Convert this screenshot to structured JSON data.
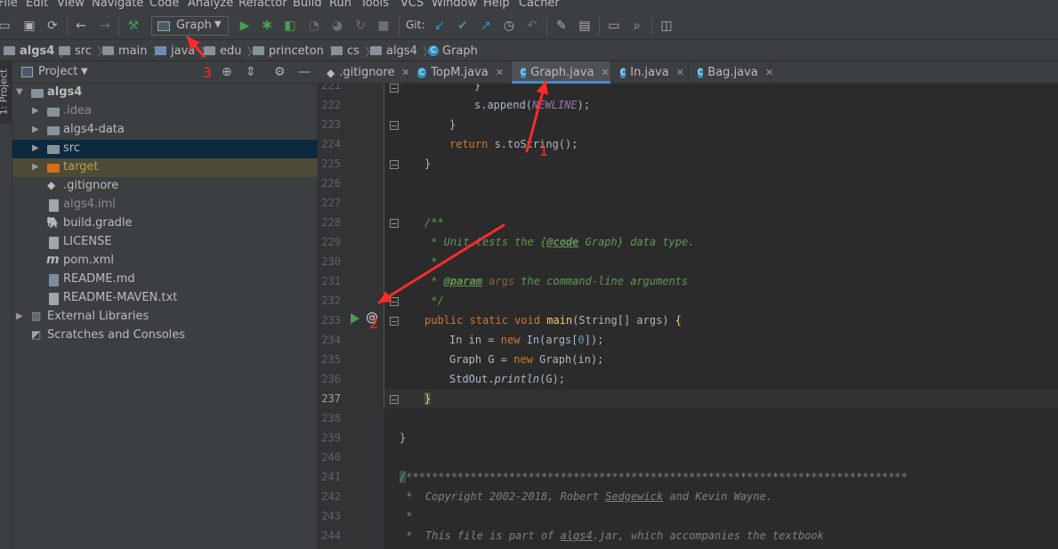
{
  "menu": [
    "File",
    "Edit",
    "View",
    "Navigate",
    "Code",
    "Analyze",
    "Refactor",
    "Build",
    "Run",
    "Tools",
    "VCS",
    "Window",
    "Help",
    "Cacher"
  ],
  "toolbar": {
    "run_config": "Graph",
    "git_label": "Git:"
  },
  "breadcrumbs": [
    "algs4",
    "src",
    "main",
    "java",
    "edu",
    "princeton",
    "cs",
    "algs4",
    "Graph"
  ],
  "side_tab": "1: Project",
  "project": {
    "title": "Project",
    "tree": [
      {
        "label": "algs4",
        "color": "#bbbbbb",
        "bold": true
      },
      {
        "label": ".idea",
        "color": "#8c8c8c"
      },
      {
        "label": "algs4-data",
        "color": "#bbbbbb"
      },
      {
        "label": "src",
        "color": "#bbbbbb"
      },
      {
        "label": "target",
        "color": "#b8a04a"
      },
      {
        "label": ".gitignore",
        "color": "#bbbbbb"
      },
      {
        "label": "algs4.iml",
        "color": "#8c8c8c"
      },
      {
        "label": "build.gradle",
        "color": "#bbbbbb"
      },
      {
        "label": "LICENSE",
        "color": "#bbbbbb"
      },
      {
        "label": "pom.xml",
        "color": "#bbbbbb"
      },
      {
        "label": "README.md",
        "color": "#bbbbbb"
      },
      {
        "label": "README-MAVEN.txt",
        "color": "#bbbbbb"
      },
      {
        "label": "External Libraries",
        "color": "#bbbbbb"
      },
      {
        "label": "Scratches and Consoles",
        "color": "#bbbbbb"
      }
    ]
  },
  "tabs": [
    {
      "label": ".gitignore",
      "active": false
    },
    {
      "label": "TopM.java",
      "active": false
    },
    {
      "label": "Graph.java",
      "active": true
    },
    {
      "label": "In.java",
      "active": false
    },
    {
      "label": "Bag.java",
      "active": false
    }
  ],
  "code": {
    "line_numbers": [
      "221",
      "222",
      "223",
      "224",
      "225",
      "226",
      "227",
      "228",
      "229",
      "230",
      "231",
      "232",
      "233",
      "234",
      "235",
      "236",
      "237",
      "238",
      "239",
      "240",
      "241",
      "242",
      "243",
      "244"
    ],
    "current_line": "237",
    "lines": {
      "l221": "}",
      "l222_a": "s.append(",
      "l222_b": "NEWLINE",
      "l222_c": ");",
      "l223": "}",
      "l224_kw": "return",
      "l224_rest": " s.toString();",
      "l225": "}",
      "l228": "/**",
      "l229_a": " * Unit tests the ",
      "l229_b": "{",
      "l229_c": "@code",
      "l229_d": " Graph}",
      "l229_e": " data type.",
      "l230": " *",
      "l231_a": " * ",
      "l231_b": "@param",
      "l231_c": " args",
      "l231_d": " the command-line arguments",
      "l232": " */",
      "l233_kw": "public static void ",
      "l233_fn": "main",
      "l233_rest": "(String[] args) ",
      "l233_brace": "{",
      "l234_a": "In in = ",
      "l234_kw": "new",
      "l234_b": " In(args[",
      "l234_num": "0",
      "l234_c": "]);",
      "l235_a": "Graph G = ",
      "l235_kw": "new",
      "l235_b": " Graph(in);",
      "l236_a": "StdOut.",
      "l236_fn": "println",
      "l236_b": "(G);",
      "l237": "}",
      "l239": "}",
      "l241_a": "/",
      "l241_b": "******************************************************************************",
      "l242_a": " *  Copyright 2002-2018, Robert ",
      "l242_b": "Sedgewick",
      "l242_c": " and Kevin Wayne.",
      "l243": " *",
      "l244_a": " *  This file is part of ",
      "l244_b": "algs4",
      "l244_c": ".jar, which accompanies the textbook"
    }
  },
  "annotations": {
    "n1": "1",
    "n2": "2",
    "n3": "3",
    "arrow_color": "#ff2a2a"
  },
  "colors": {
    "accent": "#4a88c7",
    "run_green": "#499c54",
    "selection": "#0d293e"
  }
}
